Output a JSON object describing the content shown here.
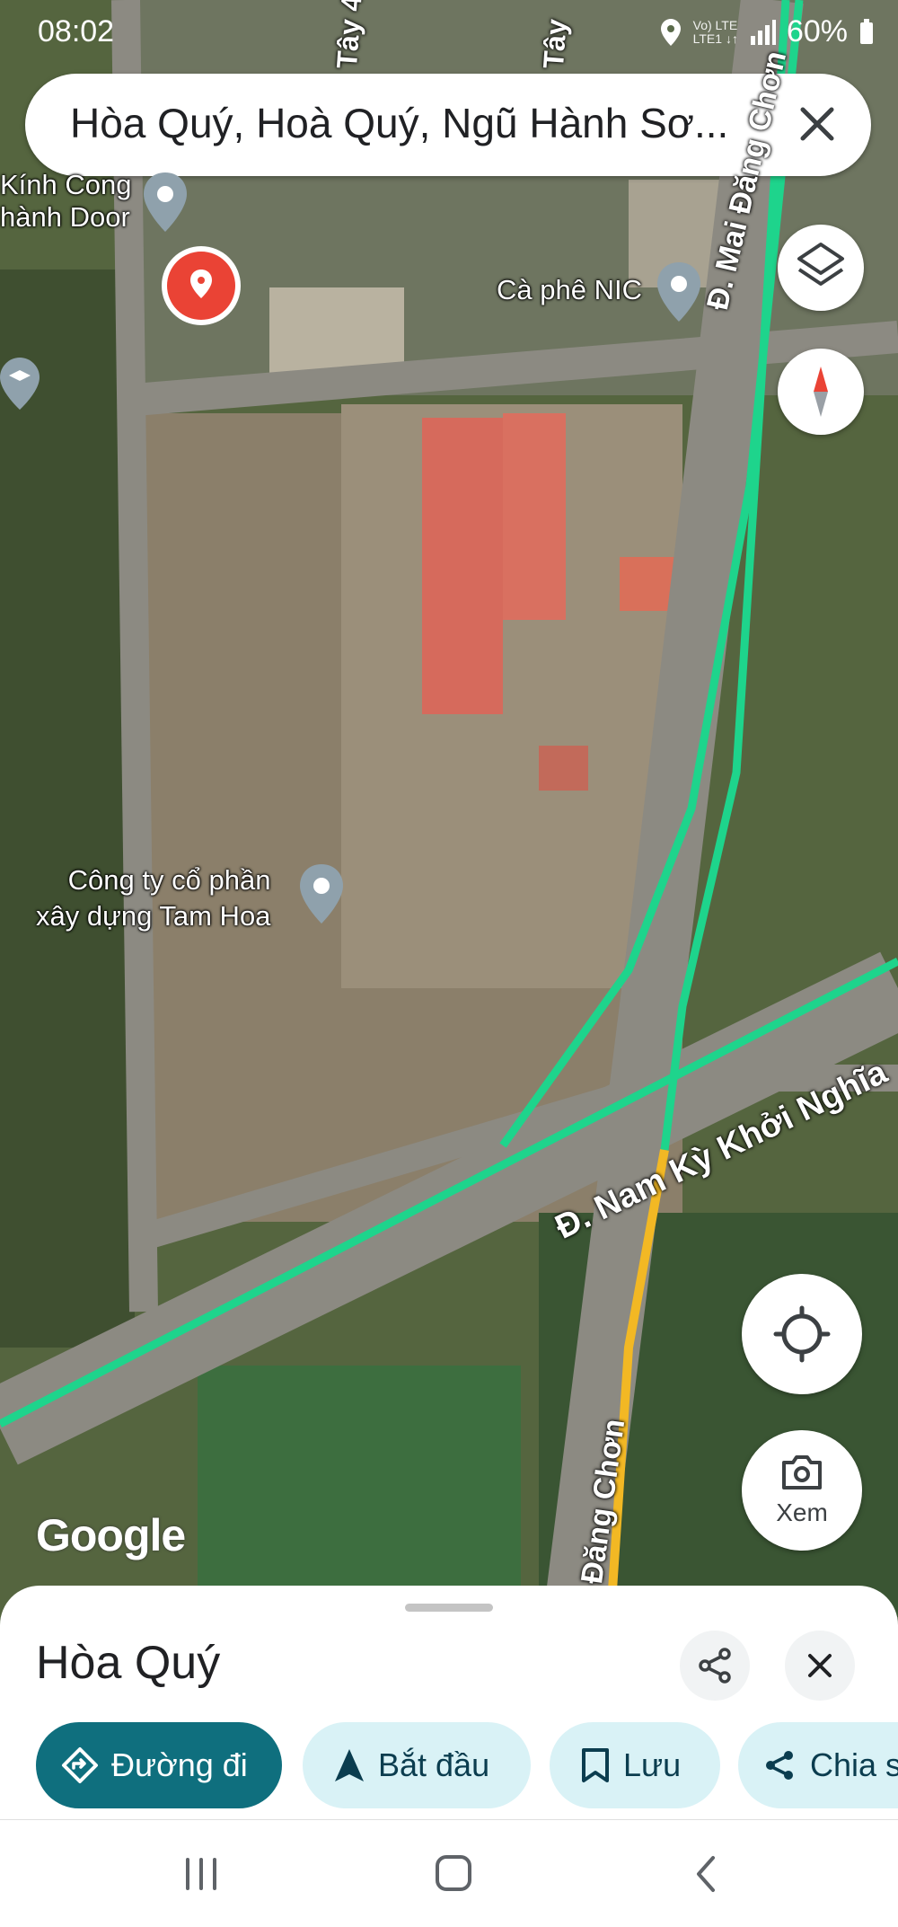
{
  "status": {
    "time": "08:02",
    "network": "Vo) LTE\nLTE1 ↓↑",
    "battery": "60%"
  },
  "search": {
    "query": "Hòa Quý, Hoà Quý, Ngũ Hành Sơ..."
  },
  "map": {
    "places": [
      {
        "name": "Kính Cong\nhành Door"
      },
      {
        "name": "Cà phê NIC"
      },
      {
        "name": "Công ty cổ phần\nxây dựng Tam Hoa"
      }
    ],
    "roads": {
      "mai_dang_chon_top": "Đ. Mai Đăng Chơn",
      "nam_ky_khoi_nghia": "Đ. Nam Kỳ Khởi Nghĩa",
      "mai_dang_chon_bottom": "Đăng Chơn",
      "tay_1": "Tây 4",
      "tay_2": "Tây"
    },
    "attribution": "Google",
    "view_button_label": "Xem"
  },
  "sheet": {
    "title": "Hòa Quý",
    "actions": [
      {
        "label": "Đường đi",
        "icon": "directions-icon"
      },
      {
        "label": "Bắt đầu",
        "icon": "navigation-arrow-icon"
      },
      {
        "label": "Lưu",
        "icon": "bookmark-icon"
      },
      {
        "label": "Chia s",
        "icon": "share-icon"
      }
    ]
  },
  "colors": {
    "accent": "#0f6f7e",
    "chip": "#d9f2f6",
    "traffic_green": "#1ed48c",
    "traffic_orange": "#f2b824",
    "pin_red": "#ea4335"
  }
}
